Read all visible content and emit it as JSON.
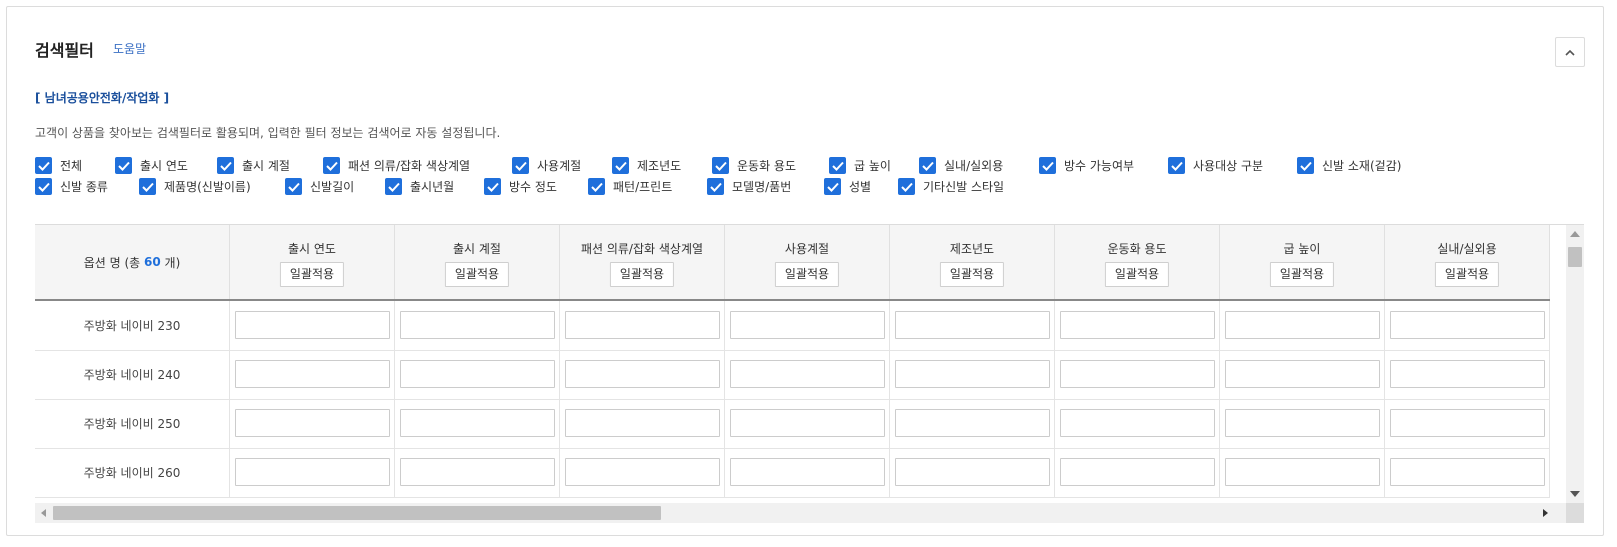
{
  "header": {
    "title": "검색필터",
    "help_link": "도움말",
    "collapse_icon": "chevron-up-icon"
  },
  "category": "[ 남녀공용안전화/작업화 ]",
  "description": "고객이 상품을 찾아보는 검색필터로 활용되며, 입력한 필터 정보는 검색어로 자동 설정됩니다.",
  "accent_color": "#1f6fdb",
  "filters_row1": [
    {
      "label": "전체",
      "checked": true
    },
    {
      "label": "출시 연도",
      "checked": true
    },
    {
      "label": "출시 계절",
      "checked": true
    },
    {
      "label": "패션 의류/잡화 색상계열",
      "checked": true
    },
    {
      "label": "사용계절",
      "checked": true
    },
    {
      "label": "제조년도",
      "checked": true
    },
    {
      "label": "운동화 용도",
      "checked": true
    },
    {
      "label": "굽 높이",
      "checked": true
    },
    {
      "label": "실내/실외용",
      "checked": true
    },
    {
      "label": "방수 가능여부",
      "checked": true
    },
    {
      "label": "사용대상 구분",
      "checked": true
    },
    {
      "label": "신발 소재(겉감)",
      "checked": true
    }
  ],
  "filters_row2": [
    {
      "label": "신발 종류",
      "checked": true
    },
    {
      "label": "제품명(신발이름)",
      "checked": true
    },
    {
      "label": "신발길이",
      "checked": true
    },
    {
      "label": "출시년월",
      "checked": true
    },
    {
      "label": "방수 정도",
      "checked": true
    },
    {
      "label": "패턴/프린트",
      "checked": true
    },
    {
      "label": "모델명/품번",
      "checked": true
    },
    {
      "label": "성별",
      "checked": true
    },
    {
      "label": "기타신발 스타일",
      "checked": true
    }
  ],
  "table": {
    "option_header_prefix": "옵션 명 (총 ",
    "option_count": "60",
    "option_header_suffix": " 개)",
    "apply_all_label": "일괄적용",
    "columns": [
      "출시 연도",
      "출시 계절",
      "패션 의류/잡화 색상계열",
      "사용계절",
      "제조년도",
      "운동화 용도",
      "굽 높이",
      "실내/실외용"
    ],
    "rows": [
      "주방화 네이비 230",
      "주방화 네이비 240",
      "주방화 네이비 250",
      "주방화 네이비 260"
    ]
  }
}
